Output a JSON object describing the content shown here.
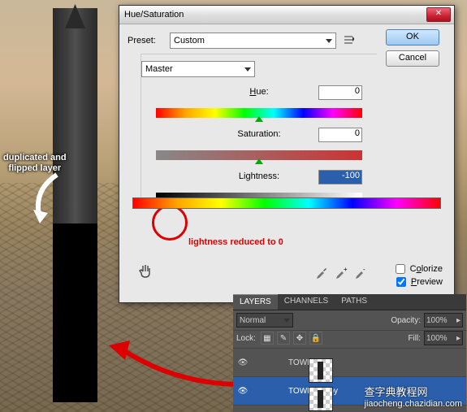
{
  "backdrop": {
    "annotation1_line1": "duplicated and",
    "annotation1_line2": "flipped layer"
  },
  "dialog": {
    "title": "Hue/Saturation",
    "preset_label": "Preset:",
    "preset_value": "Custom",
    "ok": "OK",
    "cancel": "Cancel",
    "channel": "Master",
    "hue_label": "Hue:",
    "hue_value": "0",
    "sat_label": "Saturation:",
    "sat_value": "0",
    "light_label": "Lightness:",
    "light_value": "-100",
    "lightness_anno": "lightness reduced to 0",
    "colorize": "Colorize",
    "preview": "Preview"
  },
  "layers": {
    "tab_layers": "LAYERS",
    "tab_channels": "CHANNELS",
    "tab_paths": "PATHS",
    "blend": "Normal",
    "opacity_label": "Opacity:",
    "opacity_value": "100%",
    "lock_label": "Lock:",
    "fill_label": "Fill:",
    "fill_value": "100%",
    "items": [
      {
        "name": "TOWER"
      },
      {
        "name": "TOWER copy"
      }
    ]
  },
  "watermark": {
    "cn": "查字典教程网",
    "url": "jiaocheng.chazidian.com"
  }
}
